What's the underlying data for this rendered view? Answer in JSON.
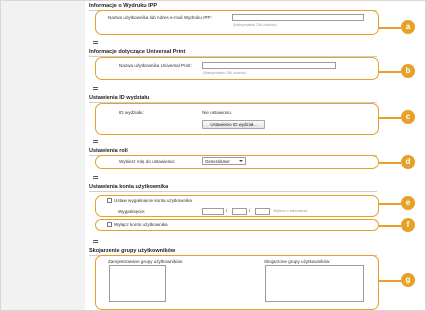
{
  "sections": {
    "ipp": {
      "title": "Informacje o Wydruku IPP",
      "field_label": "Nazwa użytkownika lub Adres e-mail Wydruku IPP:",
      "field_value": "",
      "hint": "(Maksymalnie 256 znaków)"
    },
    "universal_print": {
      "title": "Informacje dotyczące Universal Print",
      "field_label": "Nazwa użytkownika Universal Print:",
      "field_value": "",
      "hint": "(Maksymalnie 256 znaków)"
    },
    "print_id": {
      "title": "Ustawienia ID wydziału",
      "label": "ID wydziału:",
      "value": "Nie ustawiono.",
      "button": "Ustawienie ID wydział..."
    },
    "role": {
      "title": "Ustawienia roli",
      "label": "Wybierz rolę do ustawienia:",
      "selected": "GeneralUser"
    },
    "account": {
      "title": "Ustawienia konta użytkownika",
      "expiry_checkbox": "Ustaw wygaśnięcie konta użytkownika",
      "expiry_label": "Wygaśnięcie:",
      "date_sep1": "/",
      "date_sep2": "/",
      "calendar_link": "Wybierz z kalendarza",
      "disable_checkbox": "Wyłącz konto użytkownika"
    },
    "groups": {
      "title": "Skojarzenie grupy użytkowników",
      "registered_label": "Zarejestrowane grupy użytkowników:",
      "associated_label": "Skojarzone grupy użytkowników:"
    }
  },
  "badges": [
    "a",
    "b",
    "c",
    "d",
    "e",
    "f",
    "g"
  ],
  "colors": {
    "accent": "#e8a128",
    "sidebar": "#f2f2f2"
  }
}
